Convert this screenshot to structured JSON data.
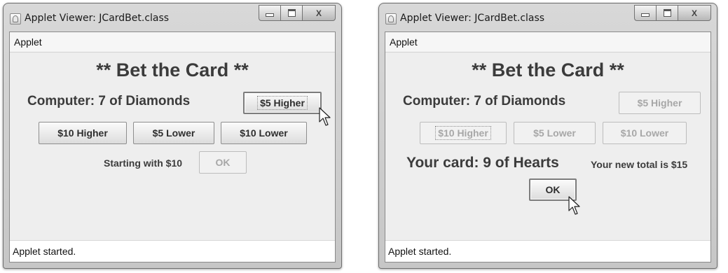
{
  "windows": [
    {
      "title": "Applet Viewer: JCardBet.class",
      "menu": "Applet",
      "heading": "** Bet the Card **",
      "computer_label": "Computer: 7 of Diamonds",
      "buttons": {
        "higher5": "$5 Higher",
        "higher10": "$10 Higher",
        "lower5": "$5 Lower",
        "lower10": "$10 Lower",
        "ok": "OK"
      },
      "starting_label": "Starting with $10",
      "status": "Applet started."
    },
    {
      "title": "Applet Viewer: JCardBet.class",
      "menu": "Applet",
      "heading": "** Bet the Card **",
      "computer_label": "Computer: 7 of Diamonds",
      "buttons": {
        "higher5": "$5 Higher",
        "higher10": "$10 Higher",
        "lower5": "$5 Lower",
        "lower10": "$10 Lower",
        "ok": "OK"
      },
      "your_card_label": "Your card: 9 of Hearts",
      "new_total_label": "Your new total is $15",
      "status": "Applet started."
    }
  ],
  "window_controls": {
    "close_glyph": "X"
  },
  "icons": [
    "java-applet-icon",
    "minimize-icon",
    "maximize-icon",
    "close-icon",
    "mouse-pointer-icon"
  ]
}
